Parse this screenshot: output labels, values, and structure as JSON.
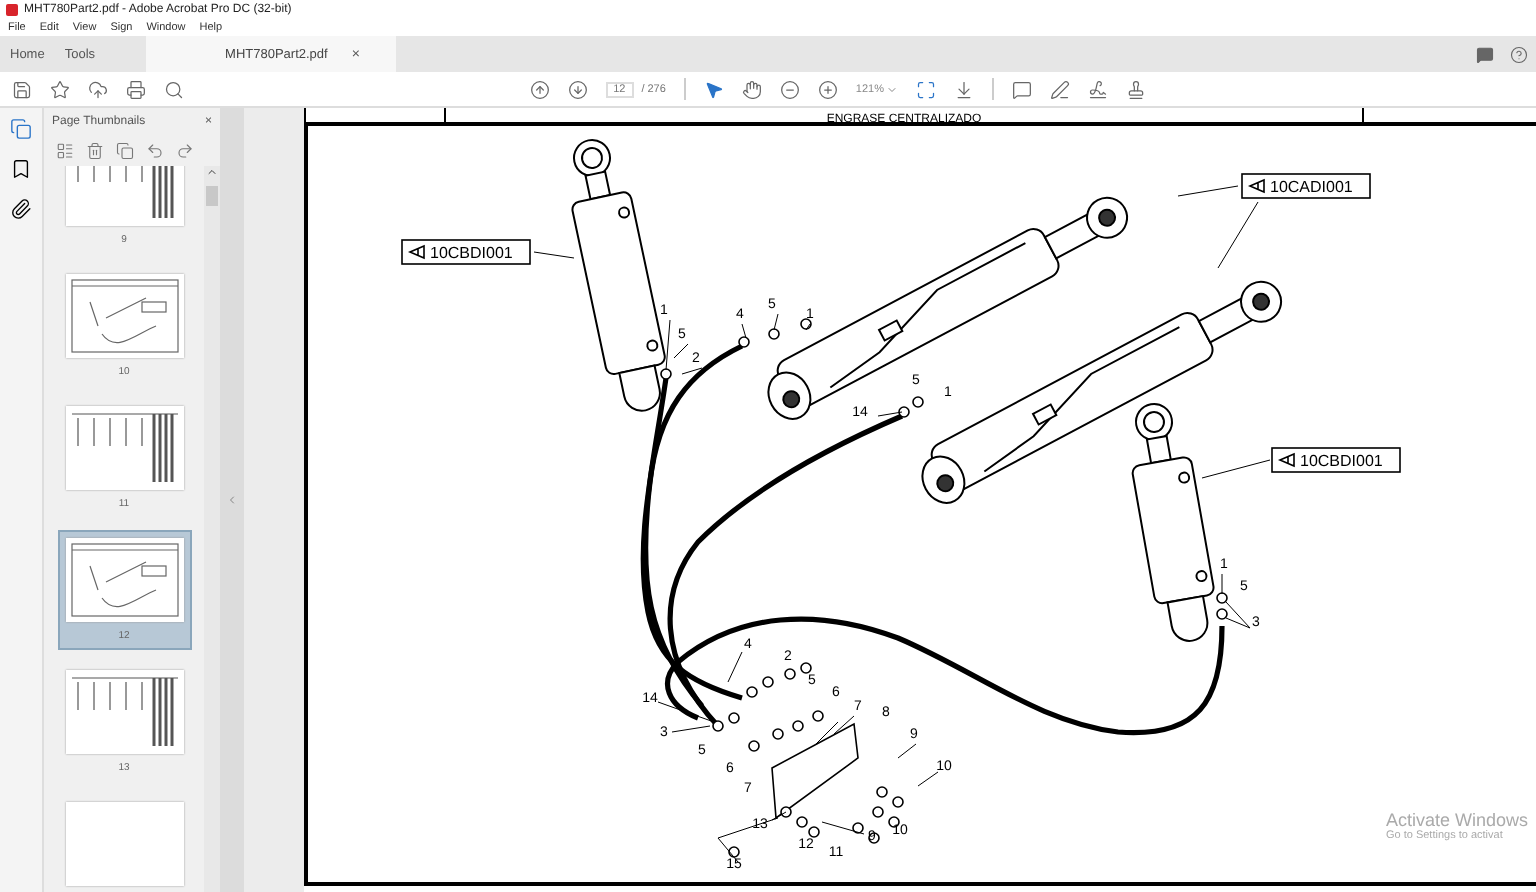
{
  "window": {
    "title": "MHT780Part2.pdf - Adobe Acrobat Pro DC (32-bit)"
  },
  "menu": [
    "File",
    "Edit",
    "View",
    "Sign",
    "Window",
    "Help"
  ],
  "tabs": [
    {
      "label": "Home",
      "selected": false
    },
    {
      "label": "Tools",
      "selected": false
    },
    {
      "label": "MHT780Part2.pdf",
      "selected": true,
      "close": "×"
    }
  ],
  "toolbar": {
    "page": "12",
    "page_total": "/ 276",
    "zoom": "121%"
  },
  "sidebar": {
    "title": "Page Thumbnails",
    "close": "×",
    "thumbnails": [
      {
        "label": "9",
        "selected": false,
        "kind": "table"
      },
      {
        "label": "10",
        "selected": false,
        "kind": "diagram"
      },
      {
        "label": "11",
        "selected": false,
        "kind": "table"
      },
      {
        "label": "12",
        "selected": true,
        "kind": "diagram"
      },
      {
        "label": "13",
        "selected": false,
        "kind": "table"
      },
      {
        "selected": false,
        "kind": "blank"
      }
    ]
  },
  "document": {
    "header": "ENGRASE CENTRALIZADO",
    "part_labels": [
      "10CBDI001",
      "10CADI001",
      "10CBDI001"
    ],
    "callouts": [
      "1",
      "5",
      "2",
      "4",
      "5",
      "1",
      "5",
      "1",
      "14",
      "1",
      "5",
      "3",
      "4",
      "2",
      "5",
      "6",
      "7",
      "8",
      "14",
      "3",
      "5",
      "6",
      "7",
      "9",
      "10",
      "9",
      "10",
      "13",
      "12",
      "11",
      "15"
    ]
  },
  "os_notice": {
    "title": "Activate Windows",
    "subtitle": "Go to Settings to activat"
  }
}
